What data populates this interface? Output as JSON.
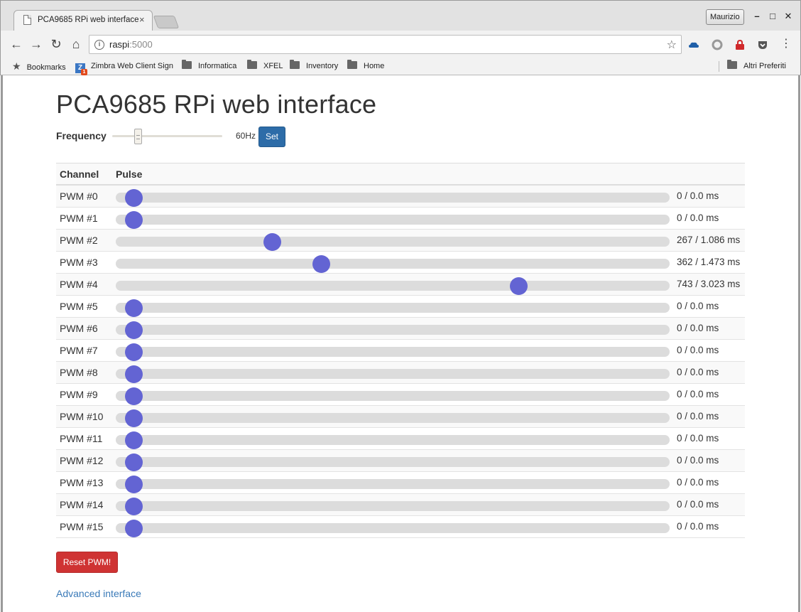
{
  "browser": {
    "tab_title": "PCA9685 RPi web interface",
    "tab_close": "×",
    "profile_name": "Maurizio",
    "url_host": "raspi",
    "url_port": ":5000",
    "bookmarks": [
      {
        "label": "Bookmarks",
        "icon": "star-icon"
      },
      {
        "label": "Zimbra Web Client Sign",
        "icon": "zimbra-icon"
      },
      {
        "label": "Informatica",
        "icon": "folder-icon"
      },
      {
        "label": "XFEL",
        "icon": "folder-icon"
      },
      {
        "label": "Inventory",
        "icon": "folder-icon"
      },
      {
        "label": "Home",
        "icon": "folder-icon"
      },
      {
        "label": "Altri Preferiti",
        "icon": "folder-icon"
      }
    ]
  },
  "page": {
    "title": "PCA9685 RPi web interface",
    "frequency": {
      "label": "Frequency",
      "value_text": "60Hz",
      "level": 0.2,
      "set_label": "Set"
    },
    "table": {
      "col_channel": "Channel",
      "col_pulse": "Pulse",
      "channels": [
        {
          "label": "PWM #0",
          "pulse": 0,
          "value_text": "0 / 0.0 ms"
        },
        {
          "label": "PWM #1",
          "pulse": 0,
          "value_text": "0 / 0.0 ms"
        },
        {
          "label": "PWM #2",
          "pulse": 267,
          "value_text": "267 / 1.086 ms"
        },
        {
          "label": "PWM #3",
          "pulse": 362,
          "value_text": "362 / 1.473 ms"
        },
        {
          "label": "PWM #4",
          "pulse": 743,
          "value_text": "743 / 3.023 ms"
        },
        {
          "label": "PWM #5",
          "pulse": 0,
          "value_text": "0 / 0.0 ms"
        },
        {
          "label": "PWM #6",
          "pulse": 0,
          "value_text": "0 / 0.0 ms"
        },
        {
          "label": "PWM #7",
          "pulse": 0,
          "value_text": "0 / 0.0 ms"
        },
        {
          "label": "PWM #8",
          "pulse": 0,
          "value_text": "0 / 0.0 ms"
        },
        {
          "label": "PWM #9",
          "pulse": 0,
          "value_text": "0 / 0.0 ms"
        },
        {
          "label": "PWM #10",
          "pulse": 0,
          "value_text": "0 / 0.0 ms"
        },
        {
          "label": "PWM #11",
          "pulse": 0,
          "value_text": "0 / 0.0 ms"
        },
        {
          "label": "PWM #12",
          "pulse": 0,
          "value_text": "0 / 0.0 ms"
        },
        {
          "label": "PWM #13",
          "pulse": 0,
          "value_text": "0 / 0.0 ms"
        },
        {
          "label": "PWM #14",
          "pulse": 0,
          "value_text": "0 / 0.0 ms"
        },
        {
          "label": "PWM #15",
          "pulse": 0,
          "value_text": "0 / 0.0 ms"
        }
      ]
    },
    "reset_label": "Reset PWM!",
    "advanced_link": "Advanced interface"
  },
  "colors": {
    "knob": "#6364d3",
    "set_button": "#2d6ca8",
    "reset_button": "#cf3333",
    "link": "#3a7ab8"
  }
}
